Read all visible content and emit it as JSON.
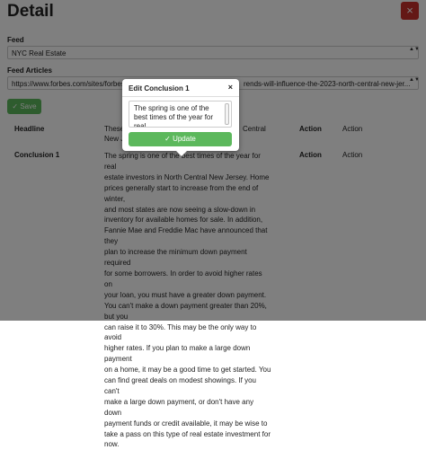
{
  "page": {
    "title": "Detail",
    "close_label": "×"
  },
  "feed": {
    "label": "Feed",
    "selected": "NYC Real Estate",
    "arrows": "▲▼"
  },
  "articles": {
    "label": "Feed Articles",
    "selected_left": "https://www.forbes.com/sites/forbes",
    "selected_right": "rends-will-influence-the-2023-north-central-new-jer...",
    "arrows": "▲▼"
  },
  "save_button": {
    "label": "Save",
    "icon": "check-icon"
  },
  "table": {
    "headers": {
      "headline": "Headline",
      "action1": "Action",
      "action2": "Action"
    },
    "row1": {
      "text_a": "These",
      "text_b": "Central",
      "text_c": "New J"
    },
    "row2": {
      "label": "Conclusion 1",
      "action1": "Action",
      "action2": "Action",
      "paragraph_lines": [
        "The spring is one of the best times of the year for real",
        "estate investors in North Central New Jersey. Home",
        "prices generally start to increase from the end of winter,",
        "and most states are now seeing a slow-down in",
        "inventory for available homes for sale. In addition,",
        "Fannie Mae and Freddie Mac have announced that they",
        "plan to increase the minimum down payment required",
        "for some borrowers. In order to avoid higher rates on",
        "your loan, you must have a greater down payment.",
        "You can't make a down payment greater than 20%, but you",
        "can raise it to 30%. This may be the only way to avoid",
        "higher rates. If you plan to make a large down payment",
        "on a home, it may be a good time to get started. You",
        "can find great deals on modest showings. If you can't",
        "make a large down payment, or don't have any down",
        "payment funds or credit available, it may be wise to",
        "take a pass on this type of real estate investment for",
        "now."
      ]
    }
  },
  "popover": {
    "title": "Edit Conclusion 1",
    "close_label": "×",
    "textarea_lines": [
      "The spring is one of the",
      "best times of the year for",
      "real"
    ],
    "update_label": "Update",
    "update_icon": "check-icon"
  },
  "colors": {
    "success": "#5cb85c",
    "danger": "#c9302c",
    "overlay": "rgba(0,0,0,0.5)"
  }
}
